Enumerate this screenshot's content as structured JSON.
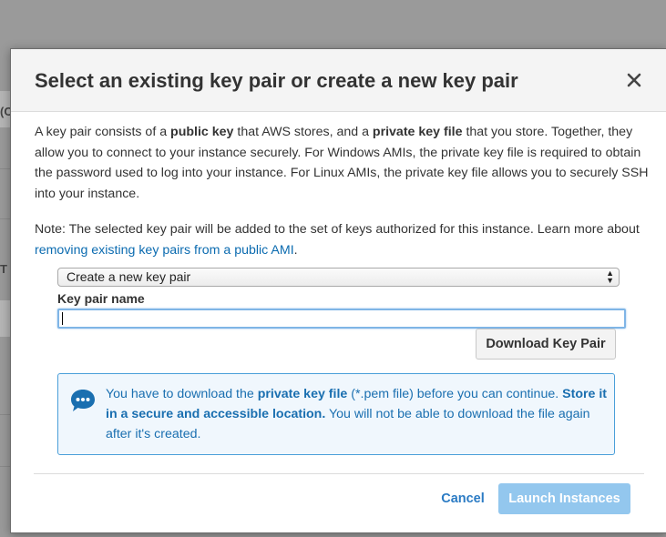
{
  "background": {
    "edge_chars": [
      "(C",
      "T"
    ]
  },
  "modal": {
    "title": "Select an existing key pair or create a new key pair",
    "close_icon": "close-icon",
    "intro": {
      "t1": "A key pair consists of a ",
      "b1": "public key",
      "t2": " that AWS stores, and a ",
      "b2": "private key file",
      "t3": " that you store. Together, they allow you to connect to your instance securely. For Windows AMIs, the private key file is required to obtain the password used to log into your instance. For Linux AMIs, the private key file allows you to securely SSH into your instance."
    },
    "note": {
      "t1": "Note: The selected key pair will be added to the set of keys authorized for this instance. Learn more about ",
      "link": "removing existing key pairs from a public AMI",
      "t2": "."
    },
    "key_pair_select": {
      "selected": "Create a new key pair"
    },
    "key_pair_name": {
      "label": "Key pair name",
      "value": "",
      "placeholder": ""
    },
    "download_button": "Download Key Pair",
    "info": {
      "icon": "chat-bubble-icon",
      "t1": "You have to download the ",
      "b1": "private key file",
      "t2": " (*.pem file) before you can continue. ",
      "b2": "Store it in a secure and accessible location.",
      "t3": " You will not be able to download the file again after it's created."
    },
    "cancel_button": "Cancel",
    "launch_button": "Launch Instances"
  },
  "colors": {
    "overlay": "#9a9a9a",
    "link": "#0b6bb0",
    "info_border": "#4a9fd9",
    "info_bg": "#f0f7fd",
    "primary_disabled": "#93c7ee"
  }
}
